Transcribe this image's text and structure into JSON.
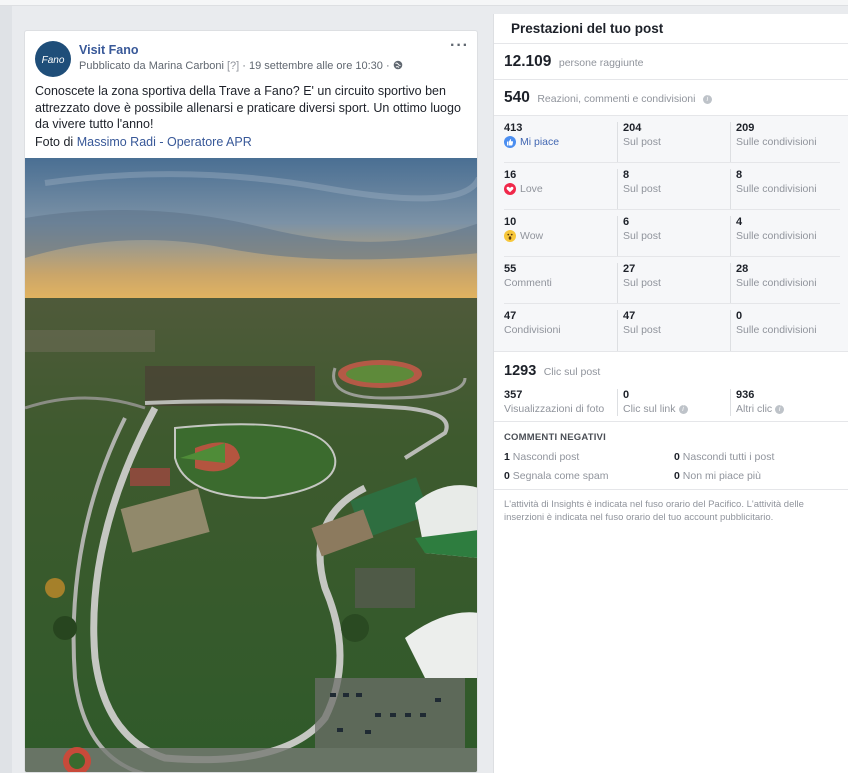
{
  "post": {
    "page_name": "Visit Fano",
    "meta_prefix": "Pubblicato da Marina Carboni",
    "meta_q": "[?]",
    "meta_date": "· 19 settembre alle ore 10:30 ·",
    "more": "···",
    "text": "Conoscete la zona sportiva della Trave a Fano? E' un circuito sportivo ben attrezzato dove è possibile allenarsi e praticare diversi sport. Un ottimo luogo da vivere tutto l'anno!",
    "credit_prefix": "Foto di",
    "credit_link": "Massimo Radi - Operatore APR",
    "avatar_text": "Fano"
  },
  "insights": {
    "title": "Prestazioni del tuo post",
    "reach_value": "12.109",
    "reach_label": "persone raggiunte",
    "engagement_value": "540",
    "engagement_label": "Reazioni, commenti e condivisioni",
    "rows": [
      {
        "total": "413",
        "label": "Mi piace",
        "icon": "like-icon",
        "on_post": "204",
        "on_post_label": "Sul post",
        "on_shares": "209",
        "on_shares_label": "Sulle condivisioni"
      },
      {
        "total": "16",
        "label": "Love",
        "icon": "love-icon",
        "on_post": "8",
        "on_post_label": "Sul post",
        "on_shares": "8",
        "on_shares_label": "Sulle condivisioni"
      },
      {
        "total": "10",
        "label": "Wow",
        "icon": "wow-icon",
        "on_post": "6",
        "on_post_label": "Sul post",
        "on_shares": "4",
        "on_shares_label": "Sulle condivisioni"
      },
      {
        "total": "55",
        "label": "Commenti",
        "on_post": "27",
        "on_post_label": "Sul post",
        "on_shares": "28",
        "on_shares_label": "Sulle condivisioni"
      },
      {
        "total": "47",
        "label": "Condivisioni",
        "on_post": "47",
        "on_post_label": "Sul post",
        "on_shares": "0",
        "on_shares_label": "Sulle condivisioni"
      }
    ],
    "clicks_value": "1293",
    "clicks_label": "Clic sul post",
    "click_breakdown": [
      {
        "value": "357",
        "label": "Visualizzazioni di foto"
      },
      {
        "value": "0",
        "label": "Clic sul link"
      },
      {
        "value": "936",
        "label": "Altri clic"
      }
    ],
    "negative_title": "COMMENTI NEGATIVI",
    "negative": [
      {
        "value": "1",
        "label": "Nascondi post"
      },
      {
        "value": "0",
        "label": "Nascondi tutti i post"
      },
      {
        "value": "0",
        "label": "Segnala come spam"
      },
      {
        "value": "0",
        "label": "Non mi piace più"
      }
    ],
    "note": "L'attività di Insights è indicata nel fuso orario del Pacifico. L'attività delle inserzioni è indicata nel fuso orario del tuo account pubblicitario.",
    "info_glyph": "i"
  },
  "colors": {
    "link": "#385898",
    "like": "#4b8ef0",
    "love": "#f0284a",
    "wow": "#f7c73b"
  }
}
